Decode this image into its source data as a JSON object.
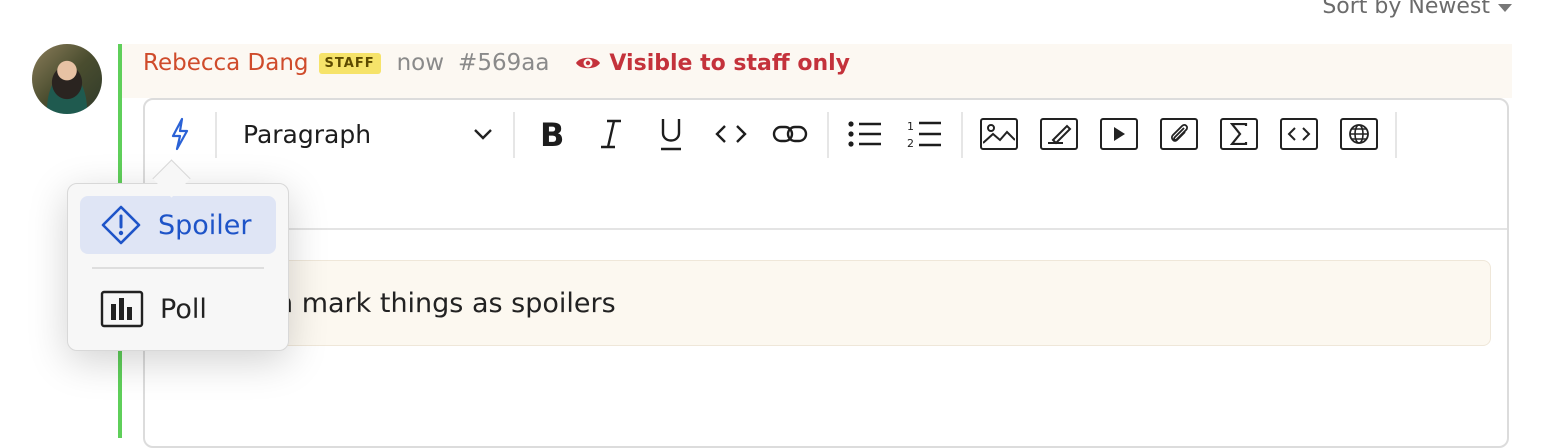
{
  "sort": {
    "label": "Sort by Newest"
  },
  "post": {
    "author": "Rebecca Dang",
    "badge": "STAFF",
    "time": "now",
    "id": "#569aa",
    "visibility": "Visible to staff only"
  },
  "toolbar": {
    "paragraph_label": "Paragraph",
    "icons": [
      "lightning-icon",
      "bold-icon",
      "italic-icon",
      "underline-icon",
      "code-icon",
      "link-icon",
      "bullet-list-icon",
      "numbered-list-icon",
      "image-icon",
      "drawing-icon",
      "video-icon",
      "attachment-icon",
      "math-icon",
      "embed-code-icon",
      "web-icon"
    ]
  },
  "editor": {
    "content_text": "n mark things as spoilers"
  },
  "popup": {
    "items": [
      {
        "label": "Spoiler",
        "icon": "spoiler-warning-icon",
        "active": true
      },
      {
        "label": "Poll",
        "icon": "poll-chart-icon",
        "active": false
      }
    ]
  },
  "colors": {
    "accent": "#1e54c8",
    "thread": "#5fcf5a",
    "author": "#cf4b2b",
    "visibility": "#c4323b"
  }
}
